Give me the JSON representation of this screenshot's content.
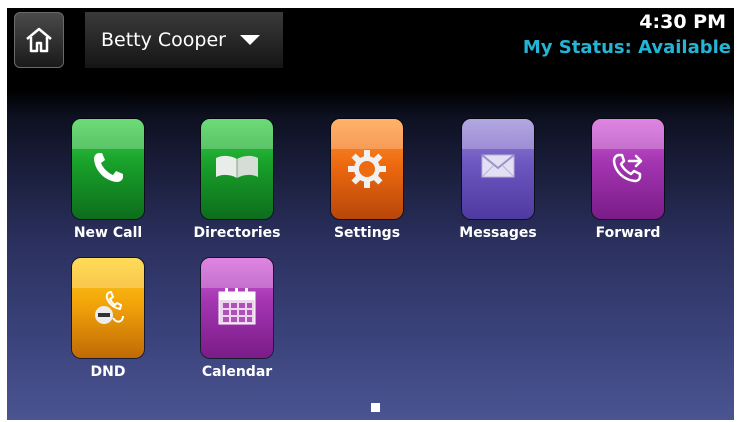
{
  "header": {
    "user_name": "Betty Cooper",
    "time": "4:30 PM",
    "status": "My Status: Available"
  },
  "apps": [
    {
      "label": "New Call"
    },
    {
      "label": "Directories"
    },
    {
      "label": "Settings"
    },
    {
      "label": "Messages"
    },
    {
      "label": "Forward"
    },
    {
      "label": "DND"
    },
    {
      "label": "Calendar"
    }
  ],
  "colors": {
    "status_text": "#22b5d6"
  }
}
